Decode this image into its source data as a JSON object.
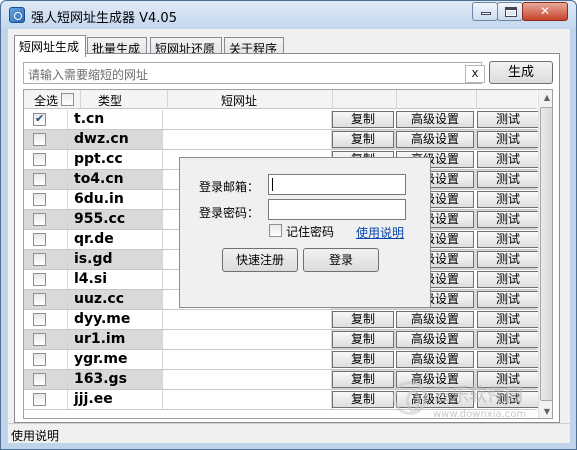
{
  "window": {
    "title": "强人短网址生成器 V4.05"
  },
  "tabs": [
    {
      "label": "短网址生成",
      "active": true
    },
    {
      "label": "批量生成",
      "active": false
    },
    {
      "label": "短网址还原",
      "active": false
    },
    {
      "label": "关于程序",
      "active": false
    }
  ],
  "input": {
    "placeholder": "请输入需要缩短的网址",
    "clear_label": "x"
  },
  "generate_label": "生成",
  "grid": {
    "headers": {
      "select_all": "全选",
      "type": "类型",
      "short_url": "短网址"
    },
    "row_buttons": {
      "copy": "复制",
      "advanced": "高级设置",
      "test": "测试"
    },
    "rows": [
      {
        "type": "t.cn",
        "checked": true
      },
      {
        "type": "dwz.cn",
        "checked": false
      },
      {
        "type": "ppt.cc",
        "checked": false
      },
      {
        "type": "to4.cn",
        "checked": false
      },
      {
        "type": "6du.in",
        "checked": false
      },
      {
        "type": "955.cc",
        "checked": false
      },
      {
        "type": "qr.de",
        "checked": false
      },
      {
        "type": "is.gd",
        "checked": false
      },
      {
        "type": "l4.si",
        "checked": false
      },
      {
        "type": "uuz.cc",
        "checked": false
      },
      {
        "type": "dyy.me",
        "checked": false
      },
      {
        "type": "ur1.im",
        "checked": false
      },
      {
        "type": "ygr.me",
        "checked": false
      },
      {
        "type": "163.gs",
        "checked": false
      },
      {
        "type": "jjj.ee",
        "checked": false
      }
    ]
  },
  "login": {
    "email_label": "登录邮箱：",
    "password_label": "登录密码：",
    "remember_label": "记住密码",
    "help_label": "使用说明",
    "register_label": "快速注册",
    "login_label": "登录"
  },
  "status_text": "使用说明",
  "watermark": {
    "title": "三乐软件园",
    "url": "www.downxia.com"
  }
}
